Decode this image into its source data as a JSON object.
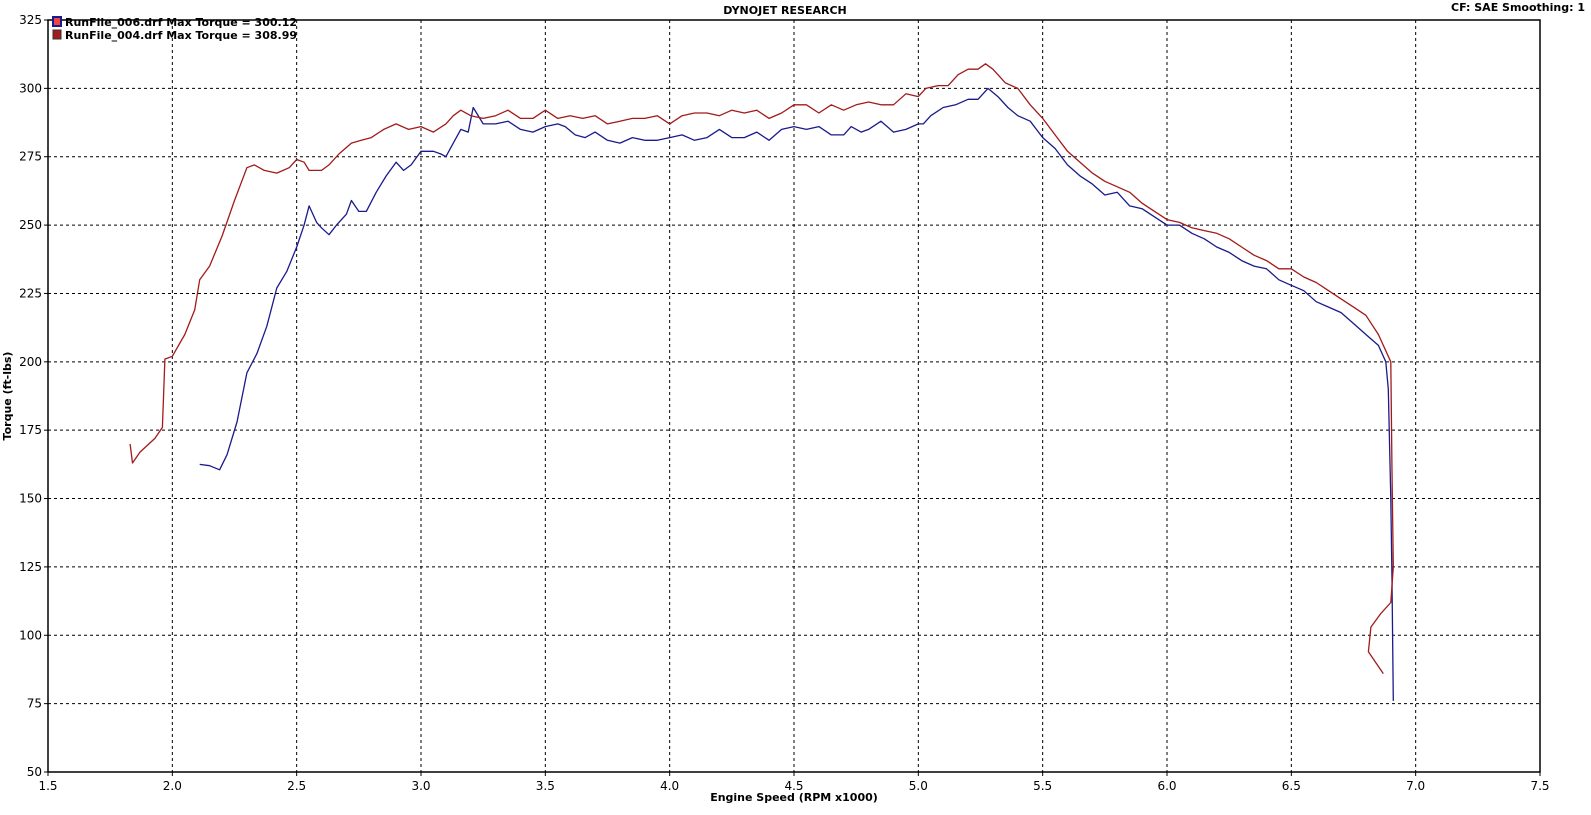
{
  "header": {
    "title": "DYNOJET RESEARCH",
    "right_info": "CF: SAE  Smoothing: 1"
  },
  "legend": [
    {
      "label": "RunFile_006.drf Max Torque = 300.12",
      "color": "#1a1a8c"
    },
    {
      "label": "RunFile_004.drf Max Torque = 308.99",
      "color": "#a31a1a"
    }
  ],
  "chart_data": {
    "type": "line",
    "title": "DYNOJET RESEARCH",
    "xlabel": "Engine Speed (RPM x1000)",
    "ylabel": "Torque (ft-lbs)",
    "xlim": [
      1.5,
      7.5
    ],
    "ylim": [
      50,
      325
    ],
    "x_ticks": [
      "1.5",
      "2.0",
      "2.5",
      "3.0",
      "3.5",
      "4.0",
      "4.5",
      "5.0",
      "5.5",
      "6.0",
      "6.5",
      "7.0",
      "7.5"
    ],
    "y_ticks": [
      "50",
      "75",
      "100",
      "125",
      "150",
      "175",
      "200",
      "225",
      "250",
      "275",
      "300",
      "325"
    ],
    "grid": true,
    "legend_position": "top-left",
    "series": [
      {
        "name": "RunFile_006.drf",
        "color": "#1a1a8c",
        "points": [
          [
            2.11,
            162.5
          ],
          [
            2.15,
            162
          ],
          [
            2.19,
            160.5
          ],
          [
            2.22,
            166
          ],
          [
            2.26,
            178
          ],
          [
            2.3,
            196
          ],
          [
            2.34,
            203
          ],
          [
            2.38,
            213
          ],
          [
            2.42,
            227
          ],
          [
            2.46,
            233
          ],
          [
            2.5,
            242
          ],
          [
            2.53,
            250
          ],
          [
            2.55,
            257
          ],
          [
            2.58,
            251
          ],
          [
            2.6,
            249
          ],
          [
            2.63,
            246.5
          ],
          [
            2.66,
            250
          ],
          [
            2.7,
            254
          ],
          [
            2.72,
            259
          ],
          [
            2.75,
            255
          ],
          [
            2.78,
            255
          ],
          [
            2.82,
            262
          ],
          [
            2.86,
            268
          ],
          [
            2.9,
            273
          ],
          [
            2.93,
            270
          ],
          [
            2.96,
            272
          ],
          [
            3.0,
            277
          ],
          [
            3.05,
            277
          ],
          [
            3.08,
            276
          ],
          [
            3.1,
            275
          ],
          [
            3.13,
            280
          ],
          [
            3.16,
            285
          ],
          [
            3.19,
            284
          ],
          [
            3.21,
            293
          ],
          [
            3.25,
            287
          ],
          [
            3.3,
            287
          ],
          [
            3.35,
            288
          ],
          [
            3.4,
            285
          ],
          [
            3.45,
            284
          ],
          [
            3.5,
            286
          ],
          [
            3.55,
            287
          ],
          [
            3.58,
            286
          ],
          [
            3.62,
            283
          ],
          [
            3.66,
            282
          ],
          [
            3.7,
            284
          ],
          [
            3.75,
            281
          ],
          [
            3.8,
            280
          ],
          [
            3.85,
            282
          ],
          [
            3.9,
            281
          ],
          [
            3.95,
            281
          ],
          [
            4.0,
            282
          ],
          [
            4.05,
            283
          ],
          [
            4.1,
            281
          ],
          [
            4.15,
            282
          ],
          [
            4.2,
            285
          ],
          [
            4.25,
            282
          ],
          [
            4.3,
            282
          ],
          [
            4.35,
            284
          ],
          [
            4.4,
            281
          ],
          [
            4.45,
            285
          ],
          [
            4.5,
            286
          ],
          [
            4.55,
            285
          ],
          [
            4.6,
            286
          ],
          [
            4.65,
            283
          ],
          [
            4.7,
            283
          ],
          [
            4.73,
            286
          ],
          [
            4.77,
            284
          ],
          [
            4.8,
            285
          ],
          [
            4.85,
            288
          ],
          [
            4.9,
            284
          ],
          [
            4.95,
            285
          ],
          [
            5.0,
            287
          ],
          [
            5.02,
            287
          ],
          [
            5.05,
            290
          ],
          [
            5.1,
            293
          ],
          [
            5.15,
            294
          ],
          [
            5.2,
            296
          ],
          [
            5.24,
            296
          ],
          [
            5.28,
            300
          ],
          [
            5.32,
            297
          ],
          [
            5.36,
            293
          ],
          [
            5.4,
            290
          ],
          [
            5.45,
            288
          ],
          [
            5.5,
            282
          ],
          [
            5.55,
            278
          ],
          [
            5.6,
            272
          ],
          [
            5.65,
            268
          ],
          [
            5.7,
            265
          ],
          [
            5.75,
            261
          ],
          [
            5.8,
            262
          ],
          [
            5.85,
            257
          ],
          [
            5.9,
            256
          ],
          [
            5.95,
            253
          ],
          [
            6.0,
            250
          ],
          [
            6.05,
            250
          ],
          [
            6.1,
            247
          ],
          [
            6.15,
            245
          ],
          [
            6.2,
            242
          ],
          [
            6.25,
            240
          ],
          [
            6.3,
            237
          ],
          [
            6.35,
            235
          ],
          [
            6.4,
            234
          ],
          [
            6.45,
            230
          ],
          [
            6.5,
            228
          ],
          [
            6.55,
            226
          ],
          [
            6.6,
            222
          ],
          [
            6.65,
            220
          ],
          [
            6.7,
            218
          ],
          [
            6.75,
            214
          ],
          [
            6.8,
            210
          ],
          [
            6.85,
            206
          ],
          [
            6.88,
            200
          ],
          [
            6.89,
            190
          ],
          [
            6.9,
            150
          ],
          [
            6.905,
            120
          ],
          [
            6.91,
            76
          ]
        ]
      },
      {
        "name": "RunFile_004.drf",
        "color": "#a31a1a",
        "points": [
          [
            1.83,
            170
          ],
          [
            1.84,
            163
          ],
          [
            1.87,
            167
          ],
          [
            1.93,
            172
          ],
          [
            1.96,
            176
          ],
          [
            1.97,
            201
          ],
          [
            2.0,
            202
          ],
          [
            2.05,
            210
          ],
          [
            2.09,
            219
          ],
          [
            2.11,
            230
          ],
          [
            2.15,
            235
          ],
          [
            2.2,
            246
          ],
          [
            2.25,
            259
          ],
          [
            2.3,
            271
          ],
          [
            2.33,
            272
          ],
          [
            2.37,
            270
          ],
          [
            2.42,
            269
          ],
          [
            2.47,
            271
          ],
          [
            2.5,
            274
          ],
          [
            2.53,
            273
          ],
          [
            2.55,
            270
          ],
          [
            2.6,
            270
          ],
          [
            2.63,
            272
          ],
          [
            2.67,
            276
          ],
          [
            2.72,
            280
          ],
          [
            2.76,
            281
          ],
          [
            2.8,
            282
          ],
          [
            2.85,
            285
          ],
          [
            2.9,
            287
          ],
          [
            2.95,
            285
          ],
          [
            3.0,
            286
          ],
          [
            3.05,
            284
          ],
          [
            3.1,
            287
          ],
          [
            3.13,
            290
          ],
          [
            3.16,
            292
          ],
          [
            3.2,
            290
          ],
          [
            3.25,
            289
          ],
          [
            3.3,
            290
          ],
          [
            3.35,
            292
          ],
          [
            3.4,
            289
          ],
          [
            3.45,
            289
          ],
          [
            3.5,
            292
          ],
          [
            3.55,
            289
          ],
          [
            3.6,
            290
          ],
          [
            3.65,
            289
          ],
          [
            3.7,
            290
          ],
          [
            3.75,
            287
          ],
          [
            3.8,
            288
          ],
          [
            3.85,
            289
          ],
          [
            3.9,
            289
          ],
          [
            3.95,
            290
          ],
          [
            4.0,
            287
          ],
          [
            4.05,
            290
          ],
          [
            4.1,
            291
          ],
          [
            4.15,
            291
          ],
          [
            4.2,
            290
          ],
          [
            4.25,
            292
          ],
          [
            4.3,
            291
          ],
          [
            4.35,
            292
          ],
          [
            4.4,
            289
          ],
          [
            4.45,
            291
          ],
          [
            4.5,
            294
          ],
          [
            4.55,
            294
          ],
          [
            4.6,
            291
          ],
          [
            4.65,
            294
          ],
          [
            4.7,
            292
          ],
          [
            4.75,
            294
          ],
          [
            4.8,
            295
          ],
          [
            4.85,
            294
          ],
          [
            4.9,
            294
          ],
          [
            4.95,
            298
          ],
          [
            5.0,
            297
          ],
          [
            5.03,
            300
          ],
          [
            5.08,
            301
          ],
          [
            5.12,
            301
          ],
          [
            5.16,
            305
          ],
          [
            5.2,
            307
          ],
          [
            5.24,
            307
          ],
          [
            5.27,
            309
          ],
          [
            5.3,
            307
          ],
          [
            5.35,
            302
          ],
          [
            5.4,
            300
          ],
          [
            5.45,
            294
          ],
          [
            5.5,
            289
          ],
          [
            5.55,
            283
          ],
          [
            5.6,
            277
          ],
          [
            5.65,
            273
          ],
          [
            5.7,
            269
          ],
          [
            5.75,
            266
          ],
          [
            5.8,
            264
          ],
          [
            5.85,
            262
          ],
          [
            5.9,
            258
          ],
          [
            5.95,
            255
          ],
          [
            6.0,
            252
          ],
          [
            6.05,
            251
          ],
          [
            6.1,
            249
          ],
          [
            6.15,
            248
          ],
          [
            6.2,
            247
          ],
          [
            6.25,
            245
          ],
          [
            6.3,
            242
          ],
          [
            6.35,
            239
          ],
          [
            6.4,
            237
          ],
          [
            6.45,
            234
          ],
          [
            6.5,
            234
          ],
          [
            6.55,
            231
          ],
          [
            6.6,
            229
          ],
          [
            6.65,
            226
          ],
          [
            6.7,
            223
          ],
          [
            6.75,
            220
          ],
          [
            6.8,
            217
          ],
          [
            6.85,
            210
          ],
          [
            6.9,
            200
          ],
          [
            6.905,
            160
          ],
          [
            6.91,
            125
          ],
          [
            6.9,
            112
          ],
          [
            6.86,
            108
          ],
          [
            6.82,
            103
          ],
          [
            6.81,
            94
          ],
          [
            6.87,
            86
          ]
        ]
      }
    ]
  }
}
